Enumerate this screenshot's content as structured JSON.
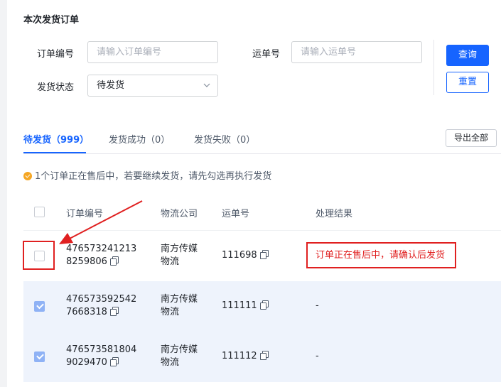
{
  "section_title": "本次发货订单",
  "filters": {
    "order_no_label": "订单编号",
    "order_no_placeholder": "请输入订单编号",
    "waybill_label": "运单号",
    "waybill_placeholder": "请输入运单号",
    "status_label": "发货状态",
    "status_value": "待发货",
    "query_button": "查询",
    "reset_button": "重置"
  },
  "tabs": [
    {
      "label": "待发货（999）"
    },
    {
      "label": "发货成功（0）"
    },
    {
      "label": "发货失败（0）"
    }
  ],
  "export_button": "导出全部",
  "notice": "1个订单正在售后中，若要继续发货，请先勾选再执行发货",
  "table": {
    "headers": [
      "订单编号",
      "物流公司",
      "运单号",
      "处理结果"
    ],
    "rows": [
      {
        "order_line1": "476573241213",
        "order_line2": "8259806",
        "company_line1": "南方传媒",
        "company_line2": "物流",
        "waybill": "111698",
        "result": "订单正在售后中，请确认后发货",
        "checked": false
      },
      {
        "order_line1": "476573592542",
        "order_line2": "7668318",
        "company_line1": "南方传媒",
        "company_line2": "物流",
        "waybill": "111111",
        "result": "-",
        "checked": true
      },
      {
        "order_line1": "476573581804",
        "order_line2": "9029470",
        "company_line1": "南方传媒",
        "company_line2": "物流",
        "waybill": "111112",
        "result": "-",
        "checked": true
      }
    ]
  },
  "colors": {
    "accent": "#1664ff",
    "annotation_red": "#e02020",
    "selected_row": "#eef3fc",
    "warning": "#f5a623"
  },
  "icons": [
    "chevron-down-icon",
    "copy-icon",
    "warning-check-icon",
    "checkbox-check-icon"
  ]
}
